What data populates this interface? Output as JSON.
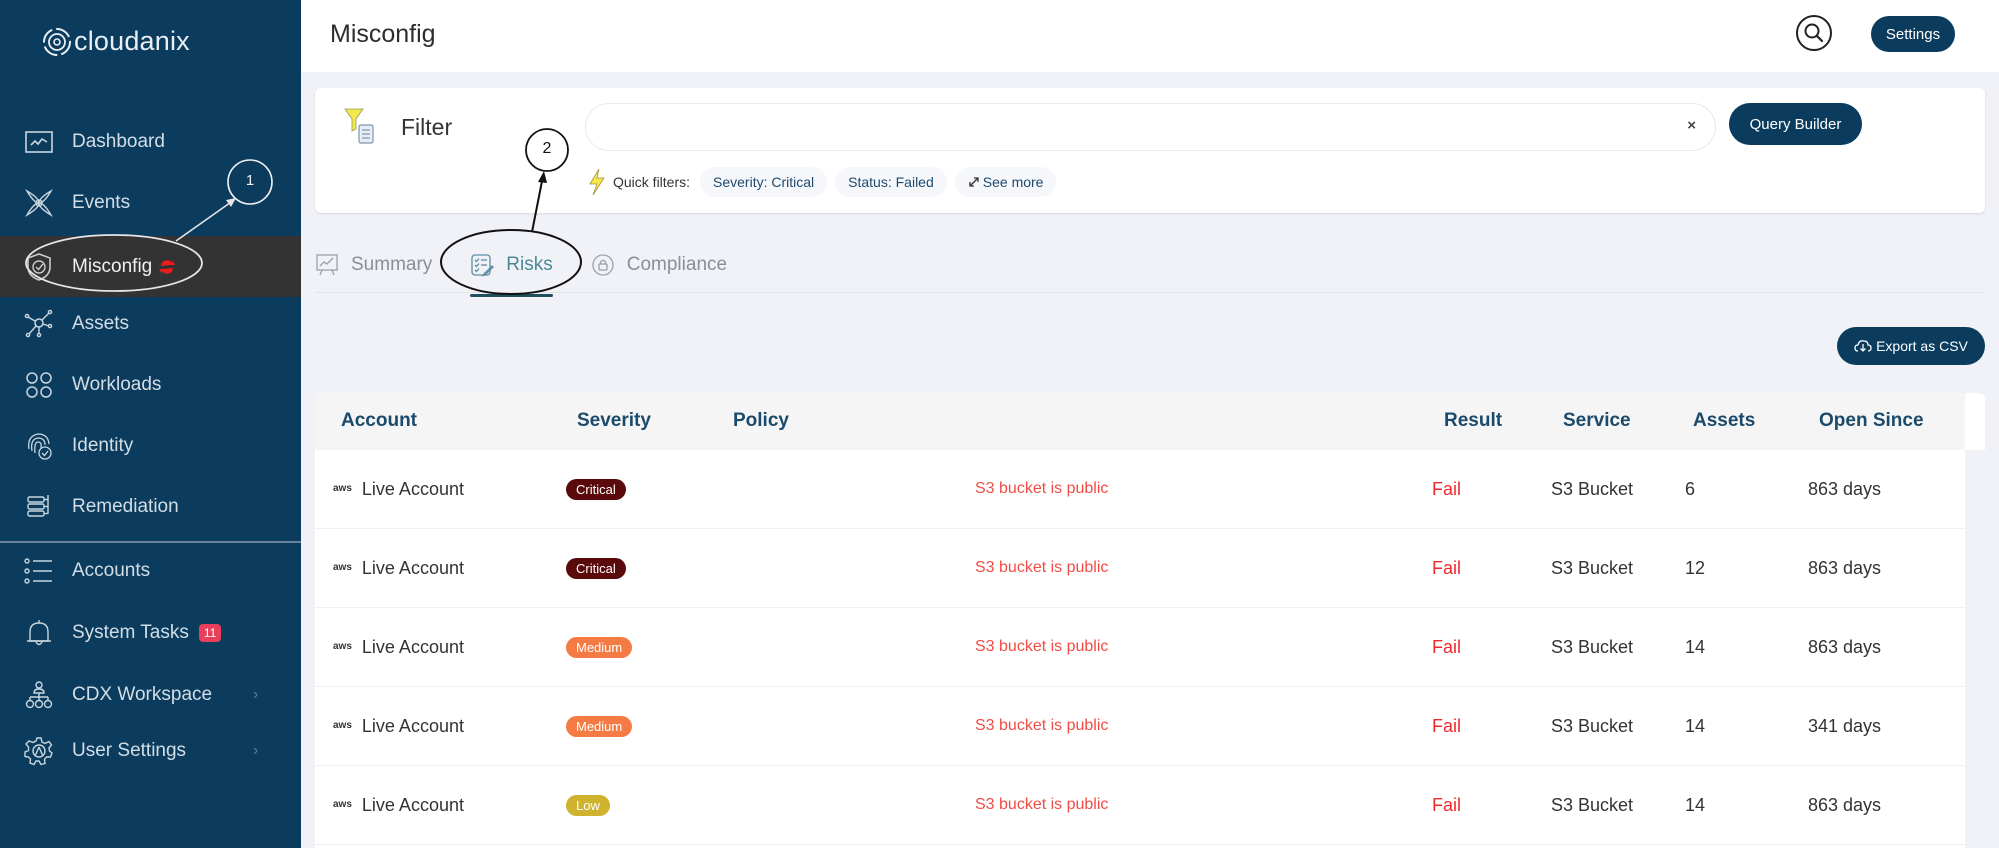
{
  "app": {
    "brand": "cloudanix"
  },
  "sidebar": {
    "items": [
      {
        "label": "Dashboard",
        "icon": "dashboard-icon"
      },
      {
        "label": "Events",
        "icon": "events-icon"
      },
      {
        "label": "Misconfig",
        "icon": "misconfig-shield-icon",
        "active": true,
        "status_icon": "sync-icon"
      },
      {
        "label": "Assets",
        "icon": "assets-icon"
      },
      {
        "label": "Workloads",
        "icon": "workloads-icon"
      },
      {
        "label": "Identity",
        "icon": "identity-fingerprint-icon"
      },
      {
        "label": "Remediation",
        "icon": "remediation-icon"
      },
      {
        "label": "Accounts",
        "icon": "accounts-list-icon"
      },
      {
        "label": "System Tasks",
        "icon": "bell-icon",
        "badge": "11"
      },
      {
        "label": "CDX Workspace",
        "icon": "workspace-icon",
        "has_submenu": true
      },
      {
        "label": "User Settings",
        "icon": "user-settings-gear-icon",
        "has_submenu": true
      }
    ],
    "chevron": "›"
  },
  "header": {
    "title": "Misconfig",
    "settings_label": "Settings"
  },
  "filter": {
    "label": "Filter",
    "input_value": "",
    "input_placeholder": "",
    "clear_label": "×",
    "query_builder_label": "Query Builder",
    "quick_filters_label": "Quick filters:",
    "quick_filters": [
      "Severity: Critical",
      "Status: Failed"
    ],
    "see_more_label": "See more"
  },
  "tabs": [
    {
      "label": "Summary",
      "active": false
    },
    {
      "label": "Risks",
      "active": true
    },
    {
      "label": "Compliance",
      "active": false
    }
  ],
  "export_label": "Export as CSV",
  "table": {
    "columns": [
      "Account",
      "Severity",
      "Policy",
      "Result",
      "Service",
      "Assets",
      "Open Since"
    ],
    "rows": [
      {
        "account": "Live Account",
        "provider": "aws",
        "severity": "Critical",
        "policy": "S3 bucket is public",
        "result": "Fail",
        "service": "S3 Bucket",
        "assets": "6",
        "open_since": "863 days"
      },
      {
        "account": "Live Account",
        "provider": "aws",
        "severity": "Critical",
        "policy": "S3 bucket is public",
        "result": "Fail",
        "service": "S3 Bucket",
        "assets": "12",
        "open_since": "863 days"
      },
      {
        "account": "Live Account",
        "provider": "aws",
        "severity": "Medium",
        "policy": "S3 bucket is public",
        "result": "Fail",
        "service": "S3 Bucket",
        "assets": "14",
        "open_since": "863 days"
      },
      {
        "account": "Live Account",
        "provider": "aws",
        "severity": "Medium",
        "policy": "S3 bucket is public",
        "result": "Fail",
        "service": "S3 Bucket",
        "assets": "14",
        "open_since": "341 days"
      },
      {
        "account": "Live Account",
        "provider": "aws",
        "severity": "Low",
        "policy": "S3 bucket is public",
        "result": "Fail",
        "service": "S3 Bucket",
        "assets": "14",
        "open_since": "863 days"
      }
    ]
  },
  "severity_colors": {
    "Critical": "#5a0a0a",
    "Medium": "#f47c44",
    "Low": "#cfb22e"
  },
  "colors": {
    "brand": "#0b3c5d",
    "fail": "#f0282d",
    "policy": "#f24b45",
    "badge": "#e8405a"
  },
  "annotations": [
    {
      "number": "1",
      "target": "Misconfig"
    },
    {
      "number": "2",
      "target": "Risks"
    }
  ]
}
